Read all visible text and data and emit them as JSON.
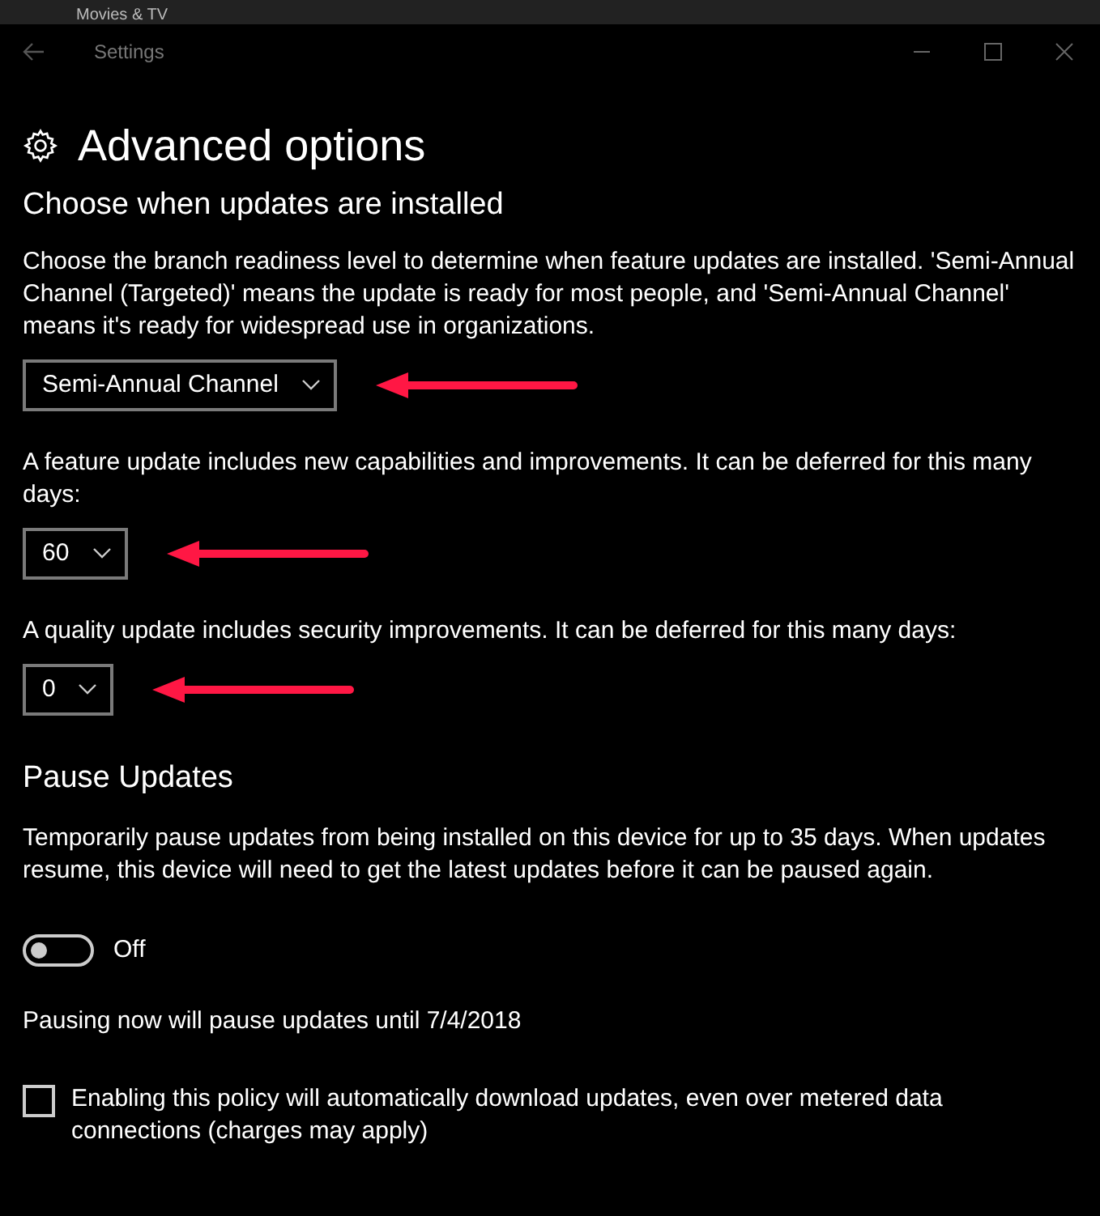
{
  "background_window": {
    "title": "Movies & TV"
  },
  "window": {
    "title": "Settings"
  },
  "page": {
    "title": "Advanced options"
  },
  "sections": [
    {
      "heading": "Choose when updates are installed",
      "items": [
        {
          "kind": "dropdown",
          "description": "Choose the branch readiness level to determine when feature updates are installed. 'Semi-Annual Channel (Targeted)' means the update is ready for most people, and 'Semi-Annual Channel' means it's ready for widespread use in organizations.",
          "value": "Semi-Annual Channel",
          "annotated": true
        },
        {
          "kind": "dropdown",
          "description": "A feature update includes new capabilities and improvements. It can be deferred for this many days:",
          "value": "60",
          "annotated": true
        },
        {
          "kind": "dropdown",
          "description": "A quality update includes security improvements. It can be deferred for this many days:",
          "value": "0",
          "annotated": true
        }
      ]
    },
    {
      "heading": "Pause Updates",
      "items": [
        {
          "kind": "text",
          "description": "Temporarily pause updates from being installed on this device for up to 35 days. When updates resume, this device will need to get the latest updates before it can be paused again."
        },
        {
          "kind": "toggle",
          "on": false,
          "label": "Off"
        },
        {
          "kind": "text",
          "description": "Pausing now will pause updates until 7/4/2018"
        },
        {
          "kind": "checkbox",
          "checked": false,
          "label": "Enabling this policy will automatically download updates, even over metered data connections (charges may apply)"
        }
      ]
    }
  ]
}
